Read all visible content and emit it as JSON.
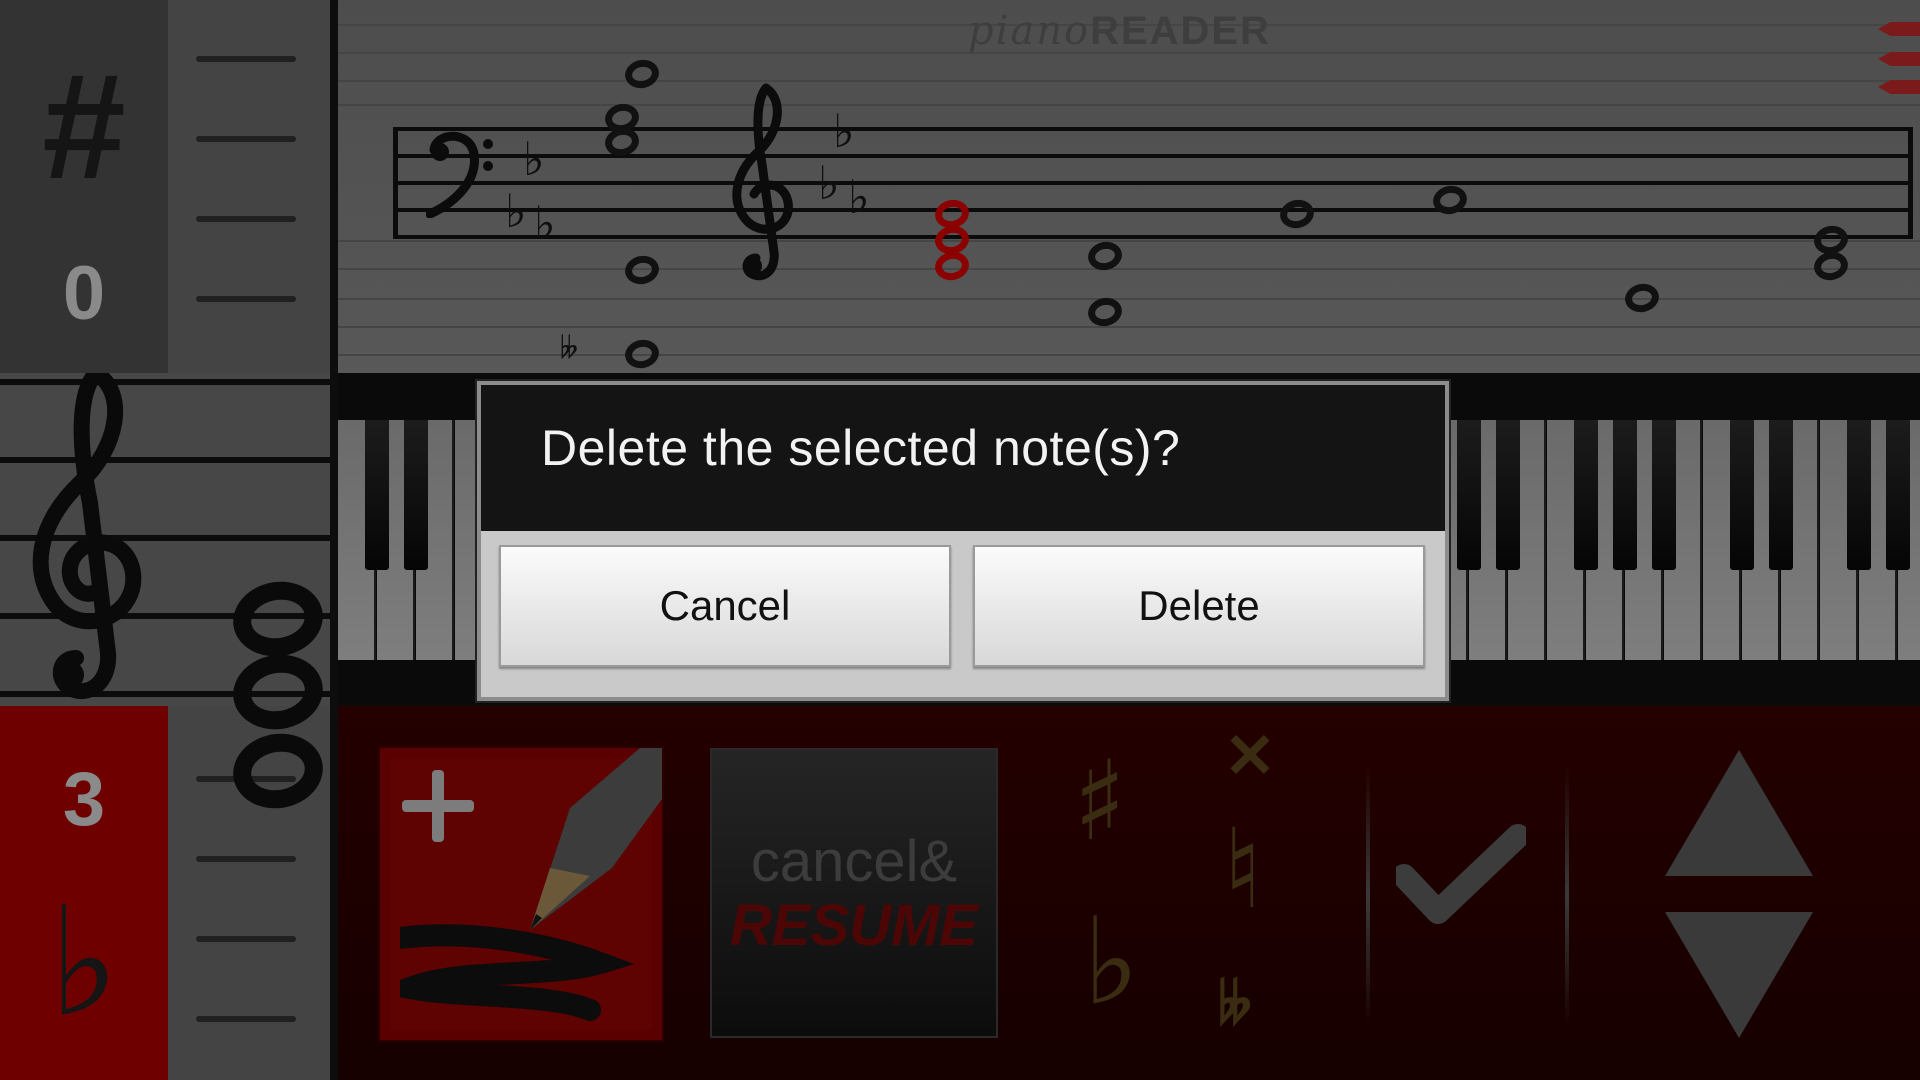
{
  "dialog": {
    "title": "Delete the selected note(s)?",
    "cancel_label": "Cancel",
    "delete_label": "Delete"
  },
  "left_panel": {
    "sharp_symbol": "#",
    "sharp_count": "0",
    "flat_count": "3",
    "flat_symbol": "♭"
  },
  "score": {
    "logo_script": "piano",
    "logo_caps": "READER",
    "double_flat": "𝄫"
  },
  "toolbar": {
    "cancel_resume_top": "cancel&",
    "cancel_resume_bottom": "RESUME",
    "sharp_symbol": "♯",
    "flat_symbol": "♭",
    "double_sharp_symbol": "✕",
    "natural_symbol": "♮",
    "double_flat_symbol": "𝄫"
  },
  "colors": {
    "accent_red": "#8b0000",
    "flat_panel_red": "#6e0000",
    "dialog_header": "#141414",
    "dialog_button": "#e6e6e6"
  },
  "icons": [
    "sharp-icon",
    "flat-icon",
    "treble-clef-icon",
    "bass-clef-icon",
    "plus-icon",
    "pencil-icon",
    "checkmark-icon",
    "arrow-up-icon",
    "arrow-down-icon",
    "double-sharp-icon",
    "natural-icon",
    "double-flat-icon"
  ]
}
